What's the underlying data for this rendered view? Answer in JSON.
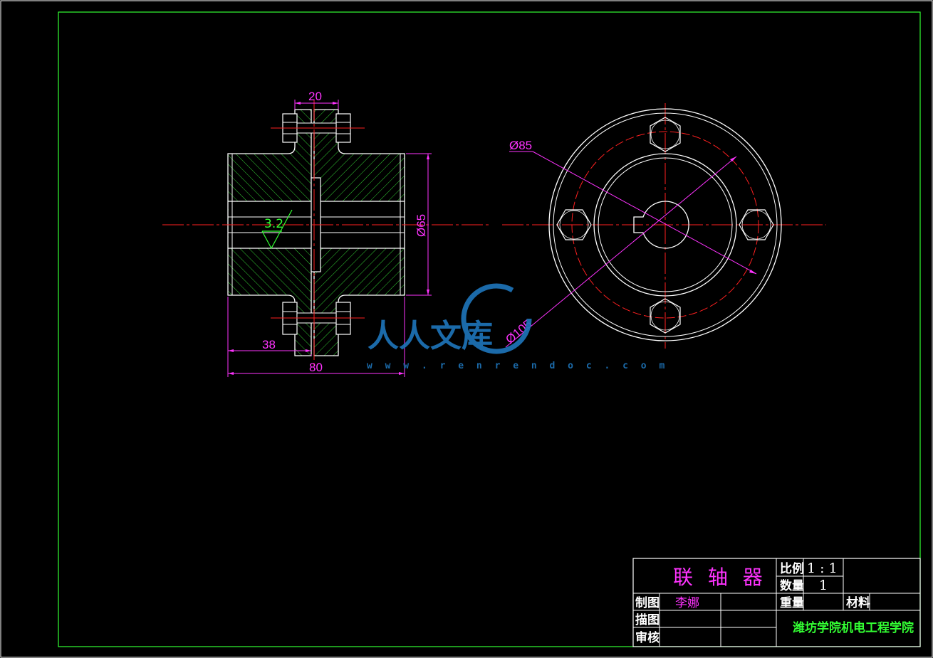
{
  "drawing": {
    "dimensions": {
      "width_top": "20",
      "hub_length": "38",
      "total_length": "80",
      "diameter_65": "Ø65",
      "diameter_85": "Ø85",
      "diameter_105": "Ø105",
      "roughness": "3.2"
    }
  },
  "title_block": {
    "part_name": "联 轴 器",
    "scale_label": "比例",
    "scale_value": "1 : 1",
    "quantity_label": "数量",
    "quantity_value": "1",
    "weight_label": "重量",
    "material_label": "材料",
    "drawn_label": "制图",
    "drawn_by": "李娜",
    "traced_label": "描图",
    "checked_label": "审核",
    "school": "潍坊学院机电工程学院"
  },
  "watermark": {
    "text": "人人文库",
    "url": "w w w . r e n r e n d o c . c o m"
  },
  "colors": {
    "frame": "#33ff33",
    "hatch": "#33cc33",
    "outline": "#ffffff",
    "dimension": "#ff33ff",
    "centerline": "#ff2020",
    "watermark": "#1e73b8"
  }
}
